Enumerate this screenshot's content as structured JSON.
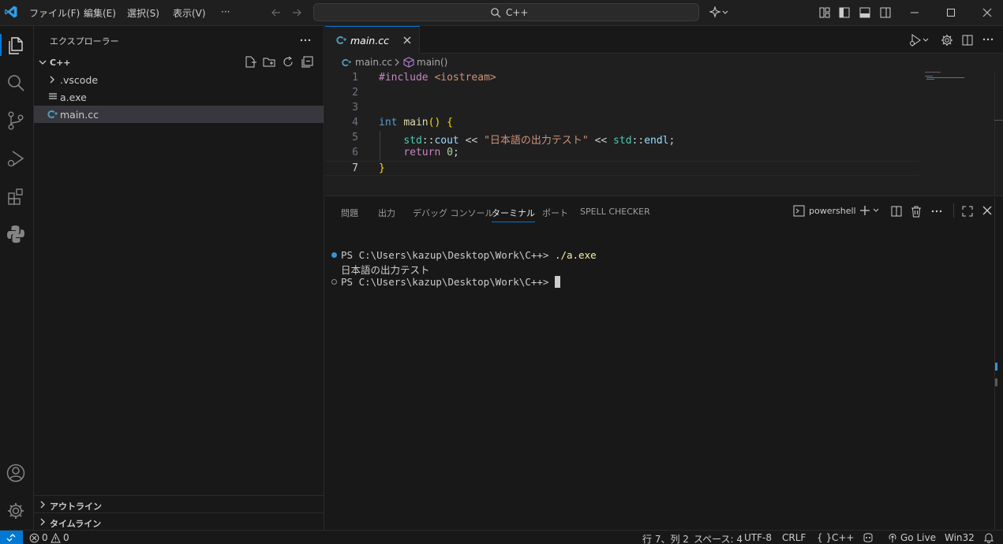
{
  "menu": {
    "file": "ファイル(F)",
    "edit": "編集(E)",
    "selection": "選択(S)",
    "view": "表示(V)",
    "more": "···"
  },
  "command_center": {
    "text": "C++"
  },
  "explorer": {
    "title": "エクスプローラー",
    "folder": "C++",
    "items": [
      {
        "label": ".vscode"
      },
      {
        "label": "a.exe"
      },
      {
        "label": "main.cc"
      }
    ],
    "outline": "アウトライン",
    "timeline": "タイムライン"
  },
  "editor": {
    "tab_label": "main.cc",
    "breadcrumb_file": "main.cc",
    "breadcrumb_symbol": "main()",
    "line_numbers": [
      "1",
      "2",
      "3",
      "4",
      "5",
      "6",
      "7"
    ],
    "include_directive": "#include",
    "include_target": "<iostream>",
    "kw_int": "int",
    "fn_main": "main",
    "parens": "()",
    "brace_open": "{",
    "std1": "std",
    "cout": "cout",
    "op_shift": "<<",
    "string_literal": "\"日本語の出力テスト\"",
    "std2": "std",
    "endl": "endl",
    "semicolon": ";",
    "kw_return": "return",
    "zero": "0",
    "brace_close": "}",
    "scope": "::"
  },
  "panel": {
    "tabs": [
      "問題",
      "出力",
      "デバッグ コンソール",
      "ターミナル",
      "ポート",
      "SPELL CHECKER"
    ],
    "active_tab": "ターミナル",
    "shell": "powershell",
    "terminal": {
      "prompt1": "PS C:\\Users\\kazup\\Desktop\\Work\\C++> ",
      "command": "./a.exe",
      "output": "日本語の出力テスト",
      "prompt2": "PS C:\\Users\\kazup\\Desktop\\Work\\C++> "
    }
  },
  "status": {
    "errors": "0",
    "warnings": "0",
    "position": "行 7、列 2",
    "spaces": "スペース: 4",
    "encoding": "UTF-8",
    "eol": "CRLF",
    "language": "C++",
    "golive": "Go Live",
    "platform": "Win32"
  },
  "colors": {
    "accent": "#0078d4",
    "editor_bg": "#1f1f1f",
    "sidebar_bg": "#181818"
  }
}
